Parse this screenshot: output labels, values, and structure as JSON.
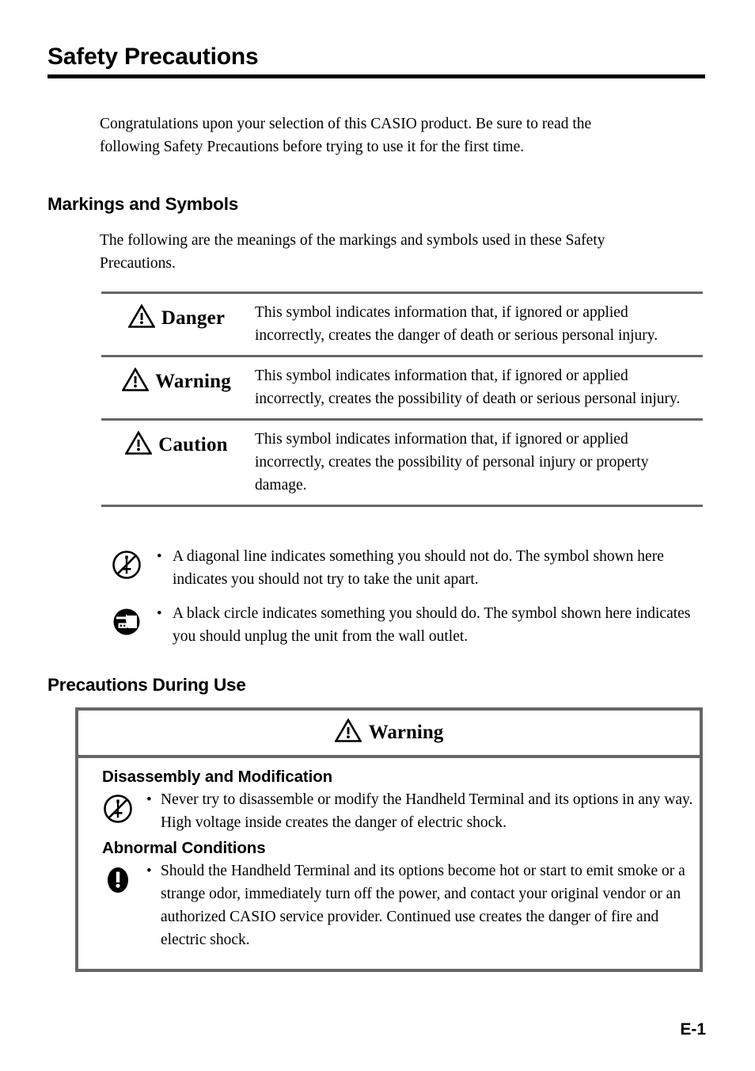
{
  "document": {
    "title": "Safety Precautions",
    "intro": "Congratulations upon your selection of this CASIO product. Be sure to read the following Safety Precautions before trying to use it for the first time.",
    "page_number": "E-1"
  },
  "markings_section": {
    "heading": "Markings and Symbols",
    "intro": "The following are the meanings of the markings and symbols used in these Safety Precautions.",
    "rows": [
      {
        "icon": "warning-triangle-icon",
        "label": "Danger",
        "description": "This symbol indicates information that, if ignored or applied incorrectly, creates the danger of death or serious personal injury."
      },
      {
        "icon": "warning-triangle-icon",
        "label": "Warning",
        "description": "This symbol indicates information that, if ignored or applied incorrectly, creates the possibility of death or serious personal injury."
      },
      {
        "icon": "warning-triangle-icon",
        "label": "Caution",
        "description": "This symbol indicates information that, if ignored or applied incorrectly, creates the possibility of personal injury or property damage."
      }
    ],
    "notes": [
      {
        "icon": "no-disassembly-icon",
        "bullet": "•",
        "text": "A diagonal line indicates something you should not do. The symbol shown here indicates you should not try to take the unit apart."
      },
      {
        "icon": "unplug-power-icon",
        "bullet": "•",
        "text": "A black circle indicates something you should do. The symbol shown here indicates you should unplug the unit from the wall outlet."
      }
    ]
  },
  "precautions_section": {
    "heading": "Precautions During Use",
    "box": {
      "header_icon": "warning-triangle-icon",
      "header_label": "Warning",
      "groups": [
        {
          "subheading": "Disassembly and Modification",
          "items": [
            {
              "icon": "no-disassembly-icon",
              "bullet": "•",
              "text": "Never try to disassemble or modify the Handheld Terminal and its options in any way. High voltage inside creates the danger of electric shock."
            }
          ]
        },
        {
          "subheading": "Abnormal Conditions",
          "items": [
            {
              "icon": "mandatory-exclamation-icon",
              "bullet": "•",
              "text": "Should the Handheld Terminal and its options become hot or start to emit smoke or a strange odor, immediately turn off the power, and contact your original vendor or an authorized CASIO service provider. Continued use creates the danger of fire and electric shock."
            }
          ]
        }
      ]
    }
  },
  "colors": {
    "rule_gray": "#666666",
    "title_rule_black": "#000000",
    "text": "#000000"
  }
}
